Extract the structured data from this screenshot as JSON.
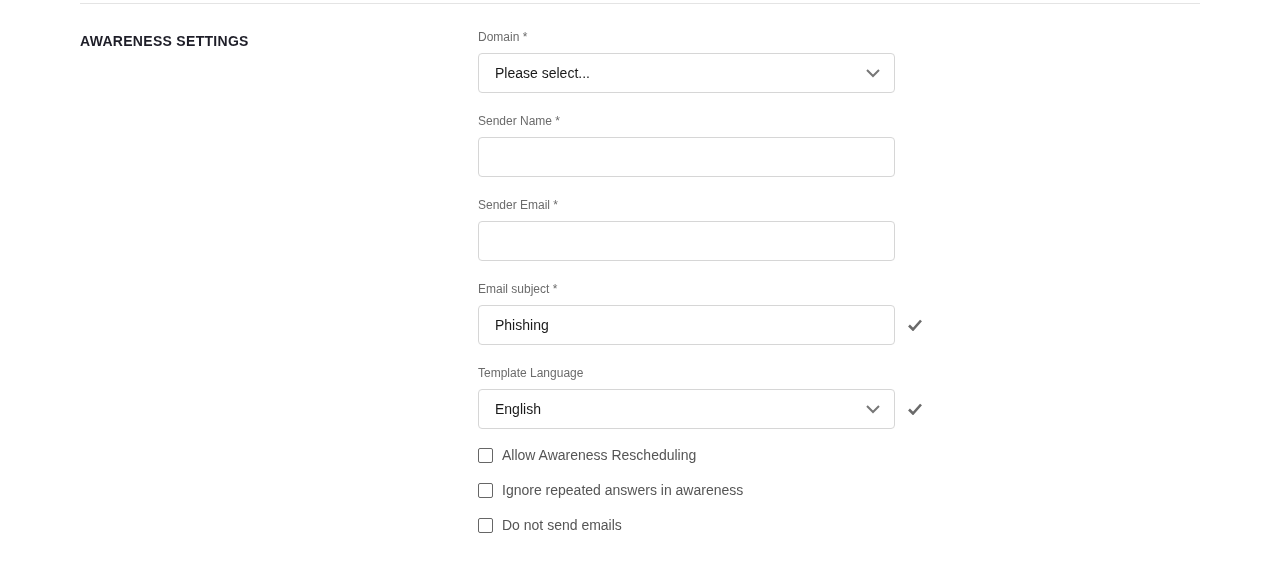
{
  "section": {
    "title": "AWARENESS SETTINGS"
  },
  "fields": [
    {
      "kind": "select",
      "label": "Domain *",
      "value": "Please select...",
      "valid": false
    },
    {
      "kind": "text",
      "label": "Sender Name *",
      "valid": false
    },
    {
      "kind": "text",
      "label": "Sender Email *",
      "valid": false
    },
    {
      "kind": "text",
      "label": "Email subject *",
      "value": "Phishing",
      "valid": true
    },
    {
      "kind": "select",
      "label": "Template Language",
      "value": "English",
      "valid": true
    }
  ],
  "options": [
    {
      "label": "Allow Awareness Rescheduling",
      "checked": false
    },
    {
      "label": "Ignore repeated answers in awareness",
      "checked": false
    },
    {
      "label": "Do not send emails",
      "checked": false
    }
  ]
}
